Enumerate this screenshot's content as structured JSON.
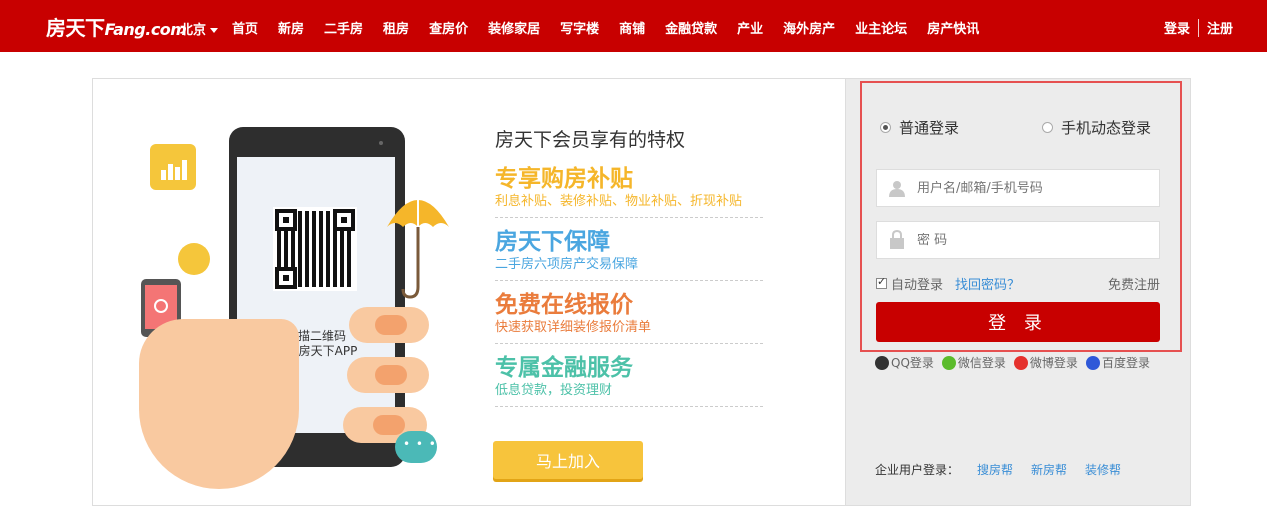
{
  "header": {
    "logo": "房天下",
    "logo_domain": "Fang.com",
    "city": "北京",
    "nav": [
      "首页",
      "新房",
      "二手房",
      "租房",
      "查房价",
      "装修家居",
      "写字楼",
      "商铺",
      "金融贷款",
      "产业",
      "海外房产",
      "业主论坛",
      "房产快讯"
    ],
    "login": "登录",
    "register": "注册"
  },
  "promo": {
    "scan_line1": "扫描二维码",
    "scan_line2": "下载房天下APP",
    "heading": "房天下会员享有的特权",
    "perks": [
      {
        "title": "专享购房补贴",
        "subtitle": "利息补贴、装修补贴、物业补贴、折现补贴",
        "color": "#f5b62a"
      },
      {
        "title": "房天下保障",
        "subtitle": "二手房六项房产交易保障",
        "color": "#4aa6e0"
      },
      {
        "title": "免费在线报价",
        "subtitle": "快速获取详细装修报价清单",
        "color": "#ea7c3c"
      },
      {
        "title": "专属金融服务",
        "subtitle": "低息贷款，投资理财",
        "color": "#4cc1a8"
      }
    ],
    "join_button": "马上加入"
  },
  "login_form": {
    "mode_normal": "普通登录",
    "mode_mobile": "手机动态登录",
    "username_placeholder": "用户名/邮箱/手机号码",
    "password_placeholder": "密 码",
    "remember": "自动登录",
    "forgot": "找回密码？",
    "free_register": "免费注册",
    "submit": "登 录"
  },
  "social_login": [
    {
      "label": "QQ登录",
      "icon": "qq-icon",
      "color": "#333"
    },
    {
      "label": "微信登录",
      "icon": "wechat-icon",
      "color": "#5bbb2b"
    },
    {
      "label": "微博登录",
      "icon": "weibo-icon",
      "color": "#e5312d"
    },
    {
      "label": "百度登录",
      "icon": "baidu-icon",
      "color": "#2f58d8"
    }
  ],
  "enterprise": {
    "label": "企业用户登录：",
    "links": [
      "搜房帮",
      "新房帮",
      "装修帮"
    ]
  },
  "colors": {
    "brand_red": "#c80000",
    "login_border": "#e65050",
    "join_yellow": "#f7c43c"
  }
}
